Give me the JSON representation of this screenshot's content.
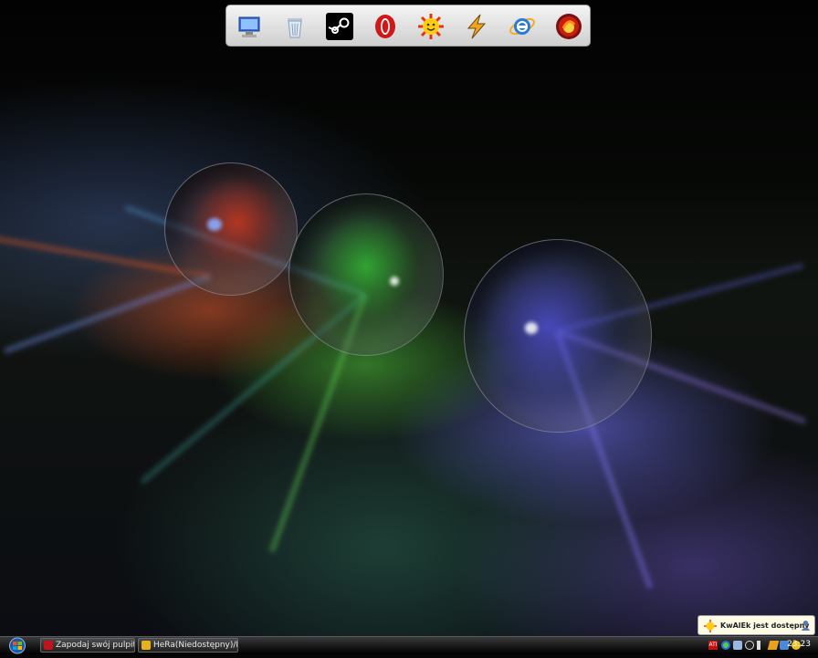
{
  "dock": {
    "items": [
      {
        "icon": "my-computer-icon",
        "title": "My Computer"
      },
      {
        "icon": "recycle-bin-icon",
        "title": "Recycle Bin"
      },
      {
        "icon": "steam-icon",
        "title": "Steam"
      },
      {
        "icon": "opera-icon",
        "title": "Opera"
      },
      {
        "icon": "sun-icon",
        "title": "Weather"
      },
      {
        "icon": "winamp-icon",
        "title": "Winamp"
      },
      {
        "icon": "internet-explorer-icon",
        "title": "Internet Explorer"
      },
      {
        "icon": "firefox-icon",
        "title": "Firefox"
      }
    ]
  },
  "taskbar": {
    "tasks": [
      {
        "label": "Zapodaj swój pulpit;) -...",
        "icon": "opera-icon",
        "color": "#c0141c"
      },
      {
        "label": "HeRa(Niedostępny)/Mi...",
        "icon": "mail-icon",
        "color": "#e8b21a"
      }
    ],
    "tray_icons": [
      "ati-icon",
      "messenger-icon",
      "network-icon",
      "steam-tray-icon",
      "volume-icon",
      "winamp-tray-icon",
      "weather-tray-icon",
      "gadu-icon"
    ],
    "clock": "23:23"
  },
  "notification": {
    "text": "KwAlEk jest dostępny"
  },
  "colors": {
    "taskbar": "#1a1a1a",
    "dock": "#dcdcdc",
    "notification": "#fdfbe6"
  }
}
